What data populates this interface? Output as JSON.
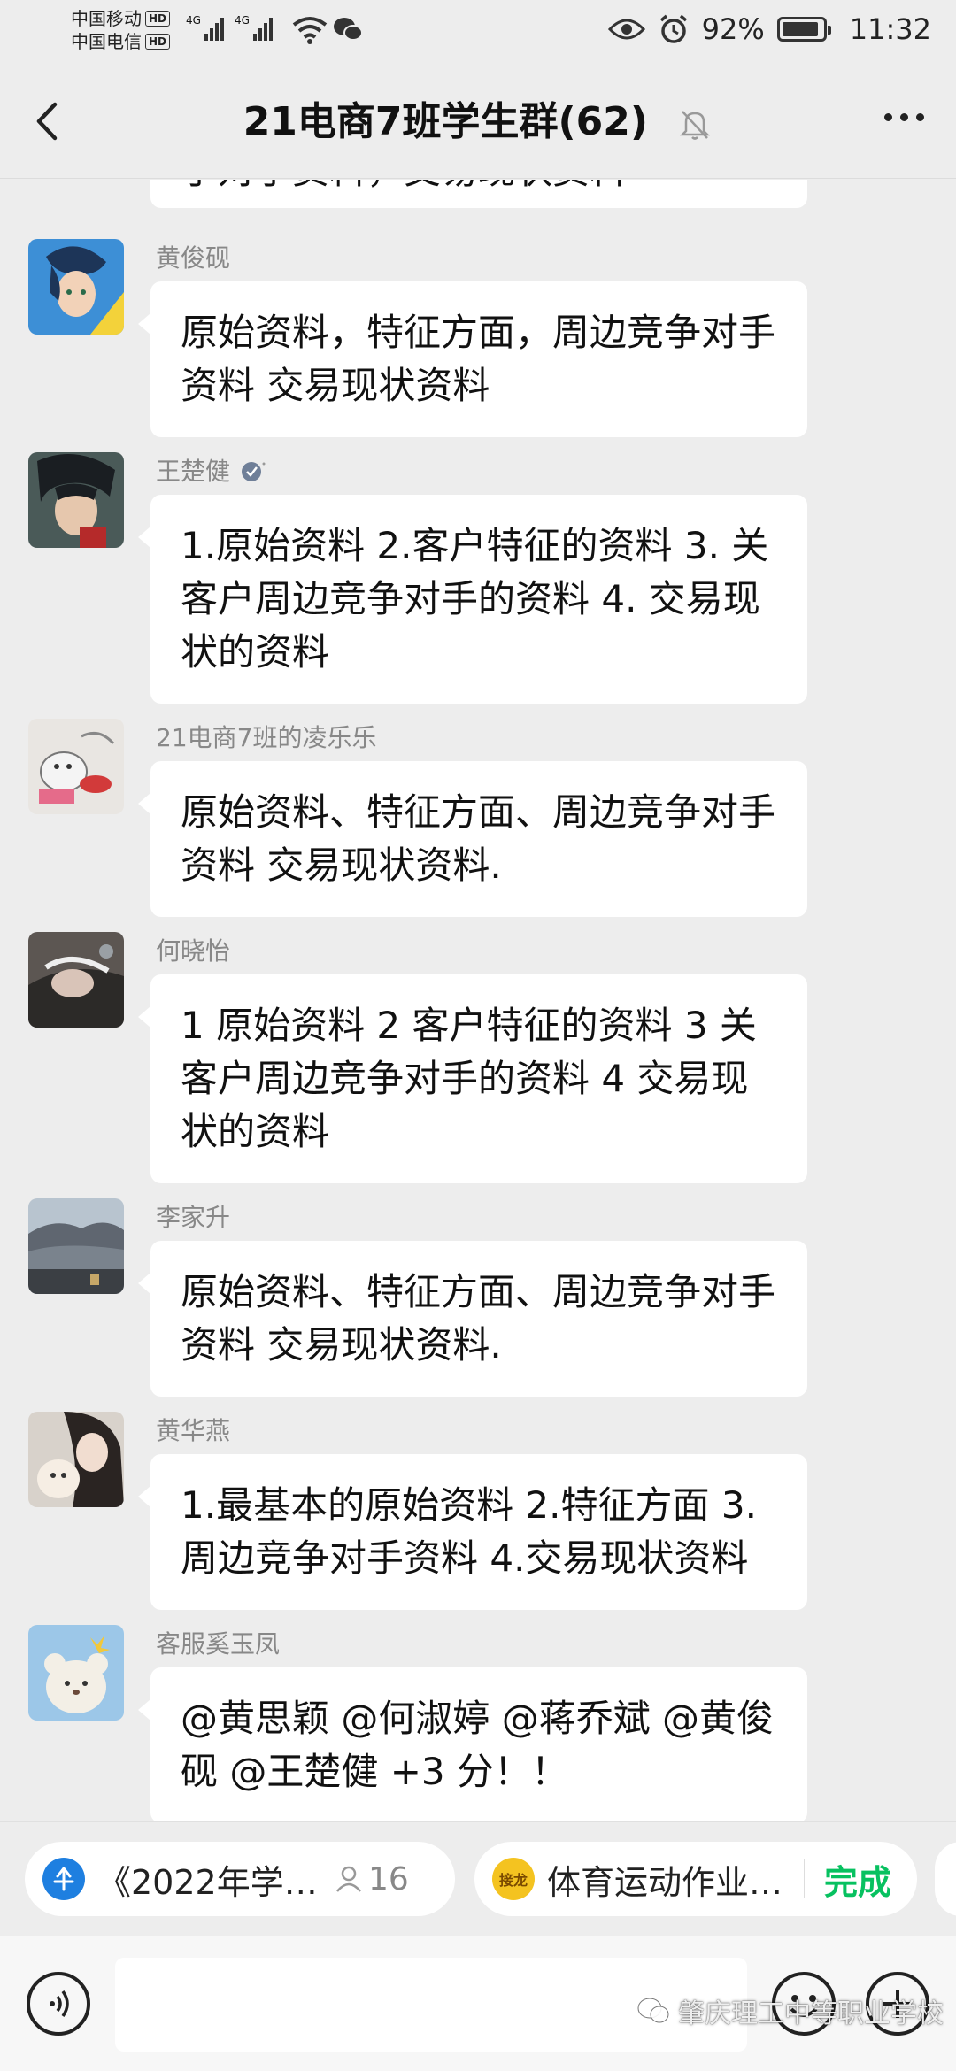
{
  "status_bar": {
    "carrier_1": "中国移动",
    "carrier_2": "中国电信",
    "hd_label": "HD",
    "network_1": "4G",
    "network_2": "4G",
    "battery_percent": "92%",
    "battery_level": 0.92,
    "time": "11:32"
  },
  "header": {
    "title": "21电商7班学生群(62)"
  },
  "chat": {
    "partial_top_text": "手对手资料，交易现状资料",
    "messages": [
      {
        "sender": "黄俊砚",
        "text": "原始资料，特征方面，周边竞争对手资料 交易现状资料"
      },
      {
        "sender": "王楚健",
        "text": "1.原始资料 2.客户特征的资料 3. 关客户周边竞争对手的资料 4. 交易现状的资料"
      },
      {
        "sender": "21电商7班的凌乐乐",
        "text": "原始资料、特征方面、周边竞争对手资料 交易现状资料."
      },
      {
        "sender": "何晓怡",
        "text": "1 原始资料 2 客户特征的资料 3 关客户周边竞争对手的资料 4 交易现状的资料"
      },
      {
        "sender": "李家升",
        "text": "原始资料、特征方面、周边竞争对手资料 交易现状资料."
      },
      {
        "sender": "黄华燕",
        "text": "1.最基本的原始资料 2.特征方面 3.周边竞争对手资料 4.交易现状资料"
      },
      {
        "sender": "客服奚玉凤",
        "text": "@黄思颖 @何淑婷 @蒋乔斌 @黄俊砚 @王楚健 +3 分！！"
      }
    ]
  },
  "pills": {
    "pill_1_text": "《2022年学生…",
    "pill_1_count": "16",
    "pill_2_badge": "接龙",
    "pill_2_text": "体育运动作业…",
    "pill_2_action": "完成"
  },
  "watermark": {
    "text": "肇庆理工中等职业学校"
  },
  "colors": {
    "background": "#ededed",
    "bubble": "#ffffff",
    "accent_green": "#07c160",
    "sender_gray": "#888888"
  }
}
